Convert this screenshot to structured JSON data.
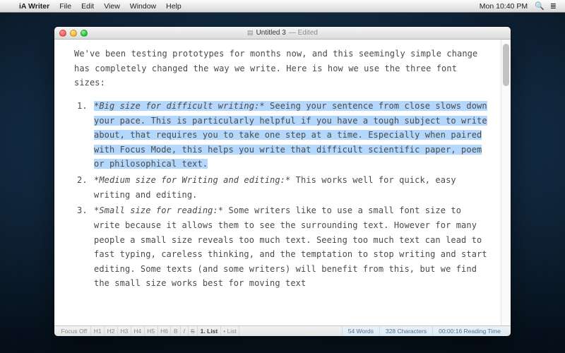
{
  "menubar": {
    "apple": "",
    "app_name": "iA Writer",
    "items": [
      "File",
      "Edit",
      "View",
      "Window",
      "Help"
    ],
    "clock": "Mon 10:40 PM",
    "spotlight": "🔍",
    "menu_extra": "≣"
  },
  "window": {
    "title_doc": "Untitled 3",
    "title_edited": "— Edited"
  },
  "editor": {
    "intro": "We've been testing prototypes for months now, and this seemingly simple change has completely changed the way we write. Here is how we use the three font sizes:",
    "item1_head": "*Big size for difficult writing:*",
    "item1_body_a": " Seeing your sentence from ",
    "item1_body_b": "close slows down your pace. This is particularly helpful if you have a tough subject to write about, that requires you to take one step at a time. Especially when paired with Focus Mode, this helps you write that difficult scientific paper, poem or philosophical text.",
    "item2_head": "*Medium size for Writing and editing:*",
    "item2_body": " This works well for quick, easy writing and editing.",
    "item3_head": "*Small size for reading:*",
    "item3_body": " Some writers like to use a small font size to write because it allows them to see the surrounding text. However for many people a small size reveals too much text. Seeing too much text can lead to fast typing, careless thinking, and the temptation to stop writing and start editing. Some texts (and some writers) will benefit from this, but we find the small size works best for moving text"
  },
  "statusbar": {
    "focus": "Focus Off",
    "h1": "H1",
    "h2": "H2",
    "h3": "H3",
    "h4": "H4",
    "h5": "H5",
    "h6": "H6",
    "b": "B",
    "i": "I",
    "s": "S",
    "list_active": "1. List",
    "list_bullet": "• List",
    "words": "54 Words",
    "chars": "328 Characters",
    "time": "00:00:16 Reading Time"
  }
}
